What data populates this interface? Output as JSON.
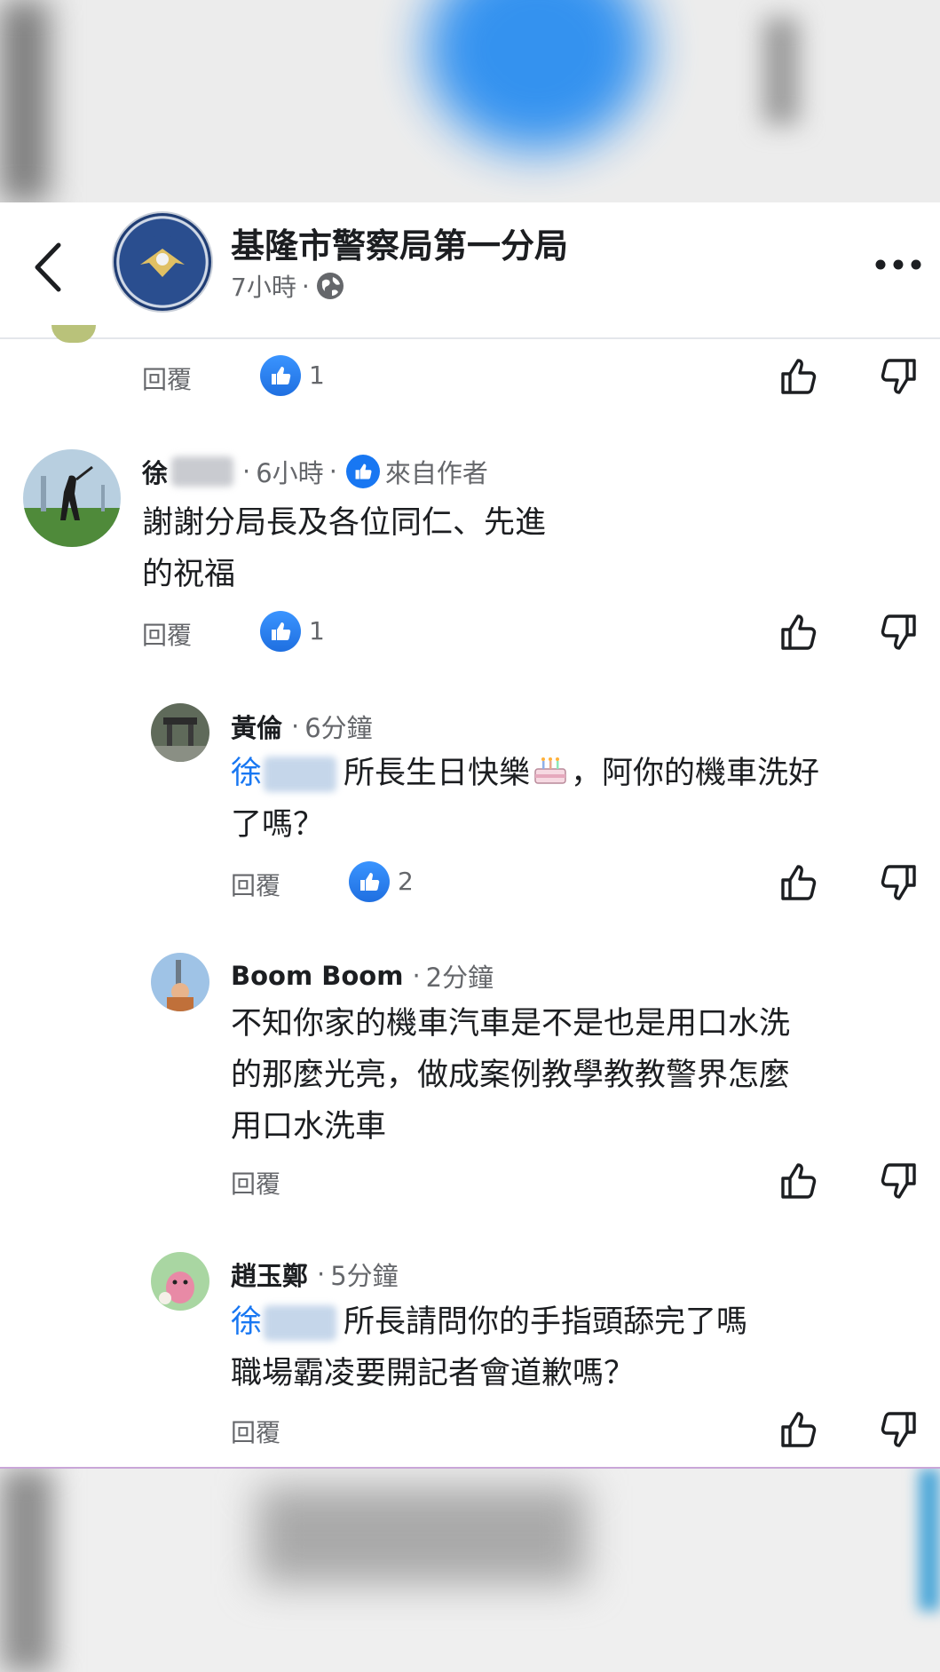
{
  "header": {
    "page_name": "基隆市警察局第一分局",
    "time": "7小時",
    "separator": "·"
  },
  "labels": {
    "reply": "回覆",
    "from_author": "來自作者"
  },
  "comments": [
    {
      "name": "徐",
      "time": "6小時",
      "text_line1": "謝謝分局長及各位同仁、先進",
      "text_line2": "的祝福",
      "likes": "1"
    },
    {
      "name": "黃倫",
      "time": "6分鐘",
      "mention": "徐",
      "text_part1": "所長生日快樂",
      "text_part2": "，阿你的機車洗好",
      "text_line2": "了嗎？",
      "likes": "2"
    },
    {
      "name": "Boom Boom",
      "time": "2分鐘",
      "text_line1": "不知你家的機車汽車是不是也是用口水洗",
      "text_line2": "的那麼光亮，做成案例教學教教警界怎麼",
      "text_line3": "用口水洗車"
    },
    {
      "name": "趙玉鄭",
      "time": "5分鐘",
      "mention": "徐",
      "text_part1": "所長請問你的手指頭舔完了嗎",
      "text_line2": "職場霸凌要開記者會道歉嗎？"
    }
  ],
  "top_reply_likes": "1",
  "icons": [
    "back-icon",
    "more-icon",
    "globe-icon",
    "like-icon",
    "dislike-icon",
    "cake-emoji"
  ],
  "colors": {
    "accent": "#1877f2",
    "meta": "#65676b",
    "text": "#1c1e21"
  }
}
